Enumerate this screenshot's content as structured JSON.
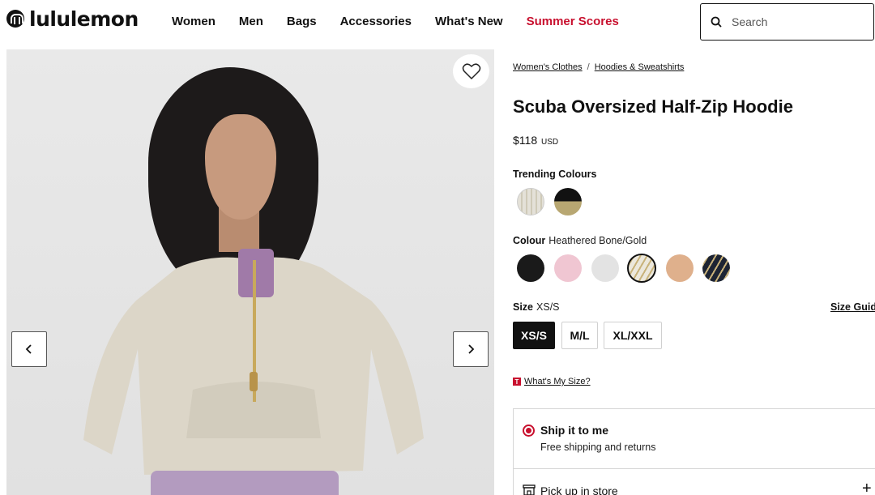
{
  "header": {
    "logo_text": "lululemon",
    "nav": [
      {
        "label": "Women"
      },
      {
        "label": "Men"
      },
      {
        "label": "Bags"
      },
      {
        "label": "Accessories"
      },
      {
        "label": "What's New"
      },
      {
        "label": "Summer Scores",
        "color": "#c8102e"
      }
    ],
    "search_placeholder": "Search"
  },
  "gallery": {
    "icons": [
      "heart-icon",
      "chevron-left-icon",
      "chevron-right-icon"
    ]
  },
  "product": {
    "breadcrumb": [
      "Women's Clothes",
      "Hoodies & Sweatshirts"
    ],
    "breadcrumb_sep": "/",
    "title": "Scuba Oversized Half-Zip Hoodie",
    "price": "$118",
    "currency": "USD",
    "trending_label": "Trending Colours",
    "trending_colours": [
      "#dcd9cf",
      "#1b1b1b"
    ],
    "colour_label": "Colour",
    "colour_value": "Heathered Bone/Gold",
    "colours": [
      "#1a1a1a",
      "#f0c6d2",
      "#e3e3e3",
      "#e8e4d8",
      "#dfb08c",
      "#1d2433"
    ],
    "selected_colour_index": 3,
    "size_label": "Size",
    "size_value": "XS/S",
    "size_guide": "Size Guid",
    "sizes": [
      "XS/S",
      "M/L",
      "XL/XXL"
    ],
    "selected_size_index": 0,
    "whats_my_size": "What's My Size?",
    "ship": {
      "title": "Ship it to me",
      "subtitle": "Free shipping and returns"
    },
    "pickup": {
      "title": "Pick up in store"
    },
    "accent": "#c8102e"
  }
}
